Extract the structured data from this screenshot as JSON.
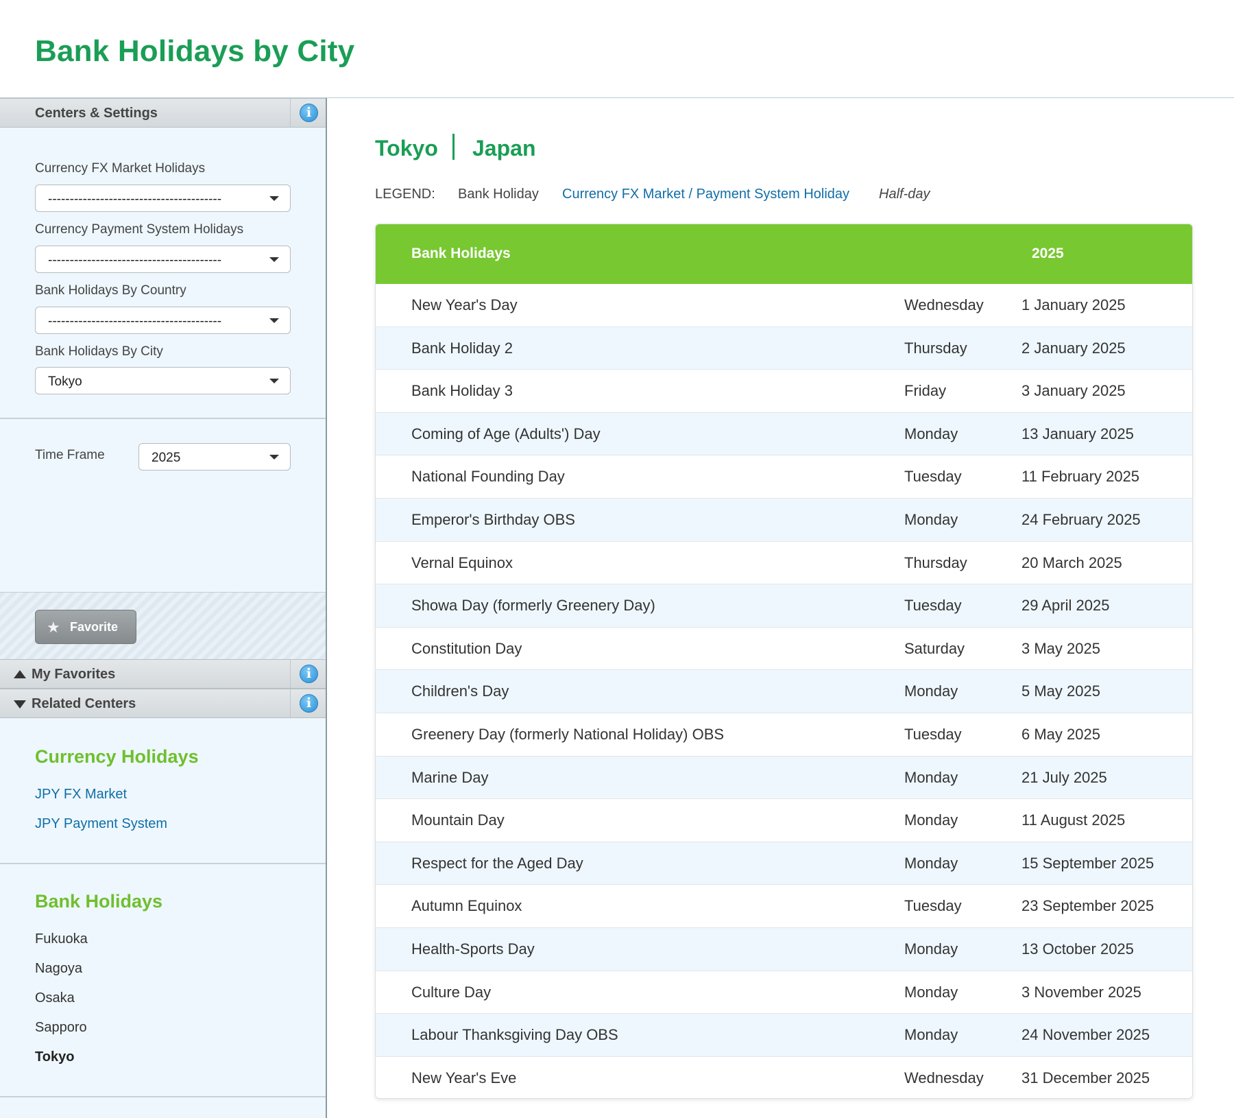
{
  "page": {
    "title": "Bank Holidays by City"
  },
  "sidebar": {
    "settings_title": "Centers & Settings",
    "fields": [
      {
        "label": "Currency FX Market Holidays",
        "value": "----------------------------------------"
      },
      {
        "label": "Currency Payment System Holidays",
        "value": "----------------------------------------"
      },
      {
        "label": "Bank Holidays By Country",
        "value": "----------------------------------------"
      },
      {
        "label": "Bank Holidays By City",
        "value": "Tokyo"
      }
    ],
    "time_frame": {
      "label": "Time Frame",
      "value": "2025"
    },
    "favorite_label": "Favorite",
    "my_favorites_title": "My Favorites",
    "related_centers_title": "Related Centers",
    "currency_section": {
      "title": "Currency Holidays",
      "links": [
        "JPY FX Market",
        "JPY Payment System"
      ]
    },
    "bank_section": {
      "title": "Bank Holidays",
      "cities": [
        "Fukuoka",
        "Nagoya",
        "Osaka",
        "Sapporo",
        "Tokyo"
      ],
      "current": "Tokyo"
    },
    "info_icon": "info-icon"
  },
  "main": {
    "city": "Tokyo",
    "country": "Japan",
    "legend": {
      "label": "LEGEND:",
      "bank": "Bank Holiday",
      "fx": "Currency FX Market / Payment System Holiday",
      "half": "Half-day"
    },
    "table": {
      "header": "Bank Holidays",
      "year": "2025",
      "rows": [
        {
          "name": "New Year's Day",
          "day": "Wednesday",
          "date": "1 January 2025"
        },
        {
          "name": "Bank Holiday 2",
          "day": "Thursday",
          "date": "2 January 2025"
        },
        {
          "name": "Bank Holiday 3",
          "day": "Friday",
          "date": "3 January 2025"
        },
        {
          "name": "Coming of Age (Adults') Day",
          "day": "Monday",
          "date": "13 January 2025"
        },
        {
          "name": "National Founding Day",
          "day": "Tuesday",
          "date": "11 February 2025"
        },
        {
          "name": "Emperor's Birthday OBS",
          "day": "Monday",
          "date": "24 February 2025"
        },
        {
          "name": "Vernal Equinox",
          "day": "Thursday",
          "date": "20 March 2025"
        },
        {
          "name": "Showa Day (formerly Greenery Day)",
          "day": "Tuesday",
          "date": "29 April 2025"
        },
        {
          "name": "Constitution Day",
          "day": "Saturday",
          "date": "3 May 2025"
        },
        {
          "name": "Children's Day",
          "day": "Monday",
          "date": "5 May 2025"
        },
        {
          "name": "Greenery Day (formerly National Holiday) OBS",
          "day": "Tuesday",
          "date": "6 May 2025"
        },
        {
          "name": "Marine Day",
          "day": "Monday",
          "date": "21 July 2025"
        },
        {
          "name": "Mountain Day",
          "day": "Monday",
          "date": "11 August 2025"
        },
        {
          "name": "Respect for the Aged Day",
          "day": "Monday",
          "date": "15 September 2025"
        },
        {
          "name": "Autumn Equinox",
          "day": "Tuesday",
          "date": "23 September 2025"
        },
        {
          "name": "Health-Sports Day",
          "day": "Monday",
          "date": "13 October 2025"
        },
        {
          "name": "Culture Day",
          "day": "Monday",
          "date": "3 November 2025"
        },
        {
          "name": "Labour Thanksgiving Day OBS",
          "day": "Monday",
          "date": "24 November 2025"
        },
        {
          "name": "New Year's Eve",
          "day": "Wednesday",
          "date": "31 December 2025"
        }
      ]
    }
  },
  "colors": {
    "title_green": "#1a9e55",
    "header_green": "#78c831",
    "section_green": "#6fbf2e",
    "link_blue": "#106ea8",
    "alt_row": "#eef7fd"
  }
}
